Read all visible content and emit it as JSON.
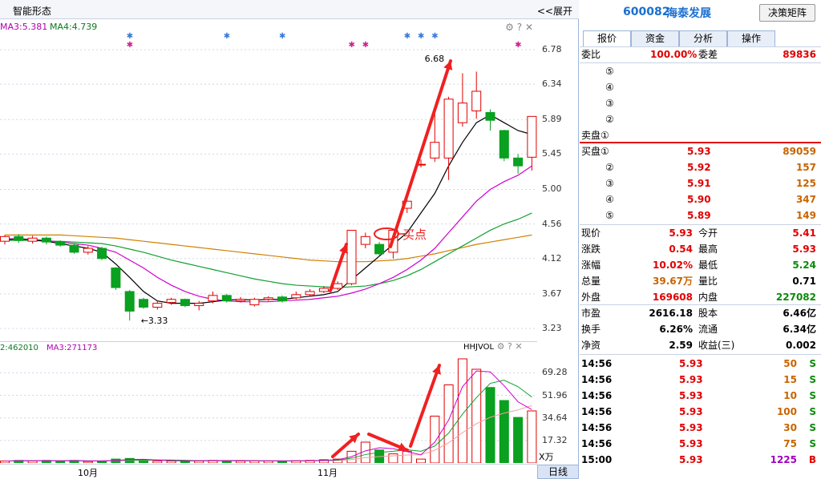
{
  "chart": {
    "title": "智能形态",
    "expand_label": "<<展开",
    "ma3_label": "MA3:5.381",
    "ma4_label": "MA4:4.739",
    "price_ticks": [
      "6.78",
      "6.34",
      "5.89",
      "5.45",
      "5.00",
      "4.56",
      "4.12",
      "3.67",
      "3.23"
    ],
    "high_label": "6.68",
    "low_label": "3.33",
    "buy_point_label": "买点",
    "vol_ma2_label": "2:462010",
    "vol_ma3_label": "MA3:271173",
    "vol_name": "HHJVOL",
    "vol_ticks": [
      "69.28",
      "51.96",
      "34.64",
      "17.32"
    ],
    "vol_unit": "X万",
    "months": [
      "10月",
      "11月"
    ],
    "day_tab": "日线",
    "colors": {
      "up": "#e00000",
      "down": "#0aa020",
      "ma_black": "#000000",
      "ma_magenta": "#d000d0",
      "ma_green": "#10a030",
      "ma_orange": "#d08000"
    }
  },
  "chart_data": {
    "type": "candlestick",
    "ylim": [
      3.23,
      6.78
    ],
    "candles": [
      {
        "o": 4.34,
        "c": 4.4,
        "h": 4.42,
        "l": 4.3
      },
      {
        "o": 4.4,
        "c": 4.35,
        "h": 4.43,
        "l": 4.32
      },
      {
        "o": 4.34,
        "c": 4.38,
        "h": 4.41,
        "l": 4.31
      },
      {
        "o": 4.38,
        "c": 4.33,
        "h": 4.4,
        "l": 4.3
      },
      {
        "o": 4.33,
        "c": 4.29,
        "h": 4.35,
        "l": 4.27
      },
      {
        "o": 4.29,
        "c": 4.2,
        "h": 4.31,
        "l": 4.18
      },
      {
        "o": 4.2,
        "c": 4.25,
        "h": 4.28,
        "l": 4.17
      },
      {
        "o": 4.25,
        "c": 4.12,
        "h": 4.27,
        "l": 4.1
      },
      {
        "o": 4.0,
        "c": 3.75,
        "h": 4.01,
        "l": 3.72
      },
      {
        "o": 3.7,
        "c": 3.45,
        "h": 3.72,
        "l": 3.33
      },
      {
        "o": 3.6,
        "c": 3.5,
        "h": 3.62,
        "l": 3.48
      },
      {
        "o": 3.5,
        "c": 3.55,
        "h": 3.58,
        "l": 3.47
      },
      {
        "o": 3.56,
        "c": 3.6,
        "h": 3.62,
        "l": 3.53
      },
      {
        "o": 3.6,
        "c": 3.52,
        "h": 3.61,
        "l": 3.5
      },
      {
        "o": 3.52,
        "c": 3.55,
        "h": 3.58,
        "l": 3.46
      },
      {
        "o": 3.58,
        "c": 3.65,
        "h": 3.7,
        "l": 3.55
      },
      {
        "o": 3.65,
        "c": 3.58,
        "h": 3.67,
        "l": 3.56
      },
      {
        "o": 3.58,
        "c": 3.6,
        "h": 3.63,
        "l": 3.56
      },
      {
        "o": 3.53,
        "c": 3.6,
        "h": 3.62,
        "l": 3.51
      },
      {
        "o": 3.6,
        "c": 3.62,
        "h": 3.64,
        "l": 3.58
      },
      {
        "o": 3.63,
        "c": 3.58,
        "h": 3.65,
        "l": 3.56
      },
      {
        "o": 3.62,
        "c": 3.66,
        "h": 3.7,
        "l": 3.6
      },
      {
        "o": 3.66,
        "c": 3.7,
        "h": 3.73,
        "l": 3.64
      },
      {
        "o": 3.7,
        "c": 3.74,
        "h": 3.77,
        "l": 3.68
      },
      {
        "o": 3.74,
        "c": 3.8,
        "h": 3.83,
        "l": 3.72
      },
      {
        "o": 3.8,
        "c": 4.48,
        "h": 4.48,
        "l": 3.78
      },
      {
        "o": 4.3,
        "c": 4.4,
        "h": 4.45,
        "l": 4.25
      },
      {
        "o": 4.3,
        "c": 4.18,
        "h": 4.33,
        "l": 4.16
      },
      {
        "o": 4.2,
        "c": 4.48,
        "h": 4.5,
        "l": 4.12
      },
      {
        "o": 4.76,
        "c": 4.85,
        "h": 4.91,
        "l": 4.7
      },
      {
        "o": 5.32,
        "c": 5.32,
        "h": 5.38,
        "l": 5.28
      },
      {
        "o": 5.4,
        "c": 5.6,
        "h": 6.0,
        "l": 5.35
      },
      {
        "o": 5.4,
        "c": 6.15,
        "h": 6.18,
        "l": 5.12
      },
      {
        "o": 5.85,
        "c": 6.1,
        "h": 6.48,
        "l": 5.8
      },
      {
        "o": 6.0,
        "c": 6.25,
        "h": 6.5,
        "l": 5.9
      },
      {
        "o": 5.98,
        "c": 5.88,
        "h": 6.02,
        "l": 5.75
      },
      {
        "o": 5.75,
        "c": 5.4,
        "h": 5.76,
        "l": 5.36
      },
      {
        "o": 5.4,
        "c": 5.3,
        "h": 5.45,
        "l": 5.2
      },
      {
        "o": 5.41,
        "c": 5.93,
        "h": 5.93,
        "l": 5.24
      }
    ],
    "ma_black": [
      4.36,
      4.37,
      4.36,
      4.34,
      4.31,
      4.28,
      4.25,
      4.2,
      4.05,
      3.88,
      3.7,
      3.58,
      3.55,
      3.55,
      3.55,
      3.57,
      3.59,
      3.6,
      3.59,
      3.6,
      3.6,
      3.62,
      3.64,
      3.66,
      3.7,
      3.85,
      4.0,
      4.15,
      4.3,
      4.45,
      4.7,
      4.95,
      5.3,
      5.6,
      5.85,
      5.95,
      5.85,
      5.75,
      5.7
    ],
    "ma_magenta": [
      4.37,
      4.37,
      4.36,
      4.35,
      4.33,
      4.31,
      4.29,
      4.25,
      4.2,
      4.1,
      4.0,
      3.88,
      3.78,
      3.7,
      3.64,
      3.6,
      3.58,
      3.57,
      3.57,
      3.57,
      3.58,
      3.59,
      3.6,
      3.62,
      3.64,
      3.68,
      3.73,
      3.8,
      3.88,
      3.98,
      4.1,
      4.25,
      4.45,
      4.65,
      4.85,
      5.0,
      5.1,
      5.18,
      5.3
    ],
    "ma_green": [
      4.35,
      4.35,
      4.35,
      4.34,
      4.34,
      4.33,
      4.32,
      4.31,
      4.28,
      4.24,
      4.2,
      4.15,
      4.1,
      4.06,
      4.02,
      3.98,
      3.94,
      3.9,
      3.86,
      3.83,
      3.8,
      3.78,
      3.77,
      3.76,
      3.75,
      3.76,
      3.77,
      3.8,
      3.84,
      3.9,
      3.98,
      4.08,
      4.18,
      4.28,
      4.38,
      4.48,
      4.56,
      4.62,
      4.7
    ],
    "ma_orange": [
      4.42,
      4.42,
      4.42,
      4.42,
      4.42,
      4.41,
      4.4,
      4.39,
      4.38,
      4.36,
      4.34,
      4.32,
      4.3,
      4.28,
      4.26,
      4.24,
      4.22,
      4.2,
      4.18,
      4.16,
      4.14,
      4.12,
      4.1,
      4.09,
      4.08,
      4.08,
      4.08,
      4.09,
      4.1,
      4.12,
      4.15,
      4.18,
      4.22,
      4.26,
      4.3,
      4.33,
      4.36,
      4.39,
      4.42
    ],
    "volume": [
      1.5,
      2,
      1.5,
      2,
      1.5,
      2,
      1.2,
      1.5,
      3,
      3.5,
      2,
      1.5,
      1.5,
      1.8,
      1.5,
      2,
      1.8,
      1.5,
      1.8,
      1.5,
      1.5,
      1.8,
      2,
      2.5,
      3,
      9,
      16,
      10,
      7,
      9,
      3,
      36,
      60,
      80,
      72,
      58,
      48,
      35,
      40
    ],
    "vol_ylim": [
      0,
      80
    ]
  },
  "stock": {
    "code": "600082",
    "name": "海泰发展",
    "strategy_button": "决策矩阵",
    "tabs": [
      "报价",
      "资金",
      "分析",
      "操作"
    ]
  },
  "quote": {
    "weibi_label": "委比",
    "weibi_value": "100.00%",
    "weicha_label": "委差",
    "weicha_value": "89836",
    "sell": [
      {
        "label": "⑤",
        "price": "",
        "vol": ""
      },
      {
        "label": "④",
        "price": "",
        "vol": ""
      },
      {
        "label": "③",
        "price": "",
        "vol": ""
      },
      {
        "label": "②",
        "price": "",
        "vol": ""
      },
      {
        "label": "卖盘①",
        "price": "",
        "vol": ""
      }
    ],
    "buy": [
      {
        "label": "买盘①",
        "price": "5.93",
        "vol": "89059"
      },
      {
        "label": "②",
        "price": "5.92",
        "vol": "157"
      },
      {
        "label": "③",
        "price": "5.91",
        "vol": "125"
      },
      {
        "label": "④",
        "price": "5.90",
        "vol": "347"
      },
      {
        "label": "⑤",
        "price": "5.89",
        "vol": "149"
      }
    ],
    "stats": [
      {
        "l1": "现价",
        "v1": "5.93",
        "c1": "red",
        "l2": "今开",
        "v2": "5.41",
        "c2": "red"
      },
      {
        "l1": "涨跌",
        "v1": "0.54",
        "c1": "red",
        "l2": "最高",
        "v2": "5.93",
        "c2": "red"
      },
      {
        "l1": "涨幅",
        "v1": "10.02%",
        "c1": "red",
        "l2": "最低",
        "v2": "5.24",
        "c2": "green"
      },
      {
        "l1": "总量",
        "v1": "39.67万",
        "c1": "orange",
        "l2": "量比",
        "v2": "0.71",
        "c2": ""
      },
      {
        "l1": "外盘",
        "v1": "169608",
        "c1": "red",
        "l2": "内盘",
        "v2": "227082",
        "c2": "green"
      }
    ],
    "stats2": [
      {
        "l1": "市盈",
        "v1": "2616.18",
        "l2": "股本",
        "v2": "6.46亿"
      },
      {
        "l1": "换手",
        "v1": "6.26%",
        "l2": "流通",
        "v2": "6.34亿"
      },
      {
        "l1": "净资",
        "v1": "2.59",
        "l2": "收益(三)",
        "v2": "0.002"
      }
    ],
    "ticks": [
      {
        "time": "14:56",
        "price": "5.93",
        "vol": "50",
        "side": "S"
      },
      {
        "time": "14:56",
        "price": "5.93",
        "vol": "15",
        "side": "S"
      },
      {
        "time": "14:56",
        "price": "5.93",
        "vol": "10",
        "side": "S"
      },
      {
        "time": "14:56",
        "price": "5.93",
        "vol": "100",
        "side": "S"
      },
      {
        "time": "14:56",
        "price": "5.93",
        "vol": "30",
        "side": "S"
      },
      {
        "time": "14:56",
        "price": "5.93",
        "vol": "75",
        "side": "S"
      },
      {
        "time": "15:00",
        "price": "5.93",
        "vol": "1225",
        "side": "B"
      }
    ]
  }
}
